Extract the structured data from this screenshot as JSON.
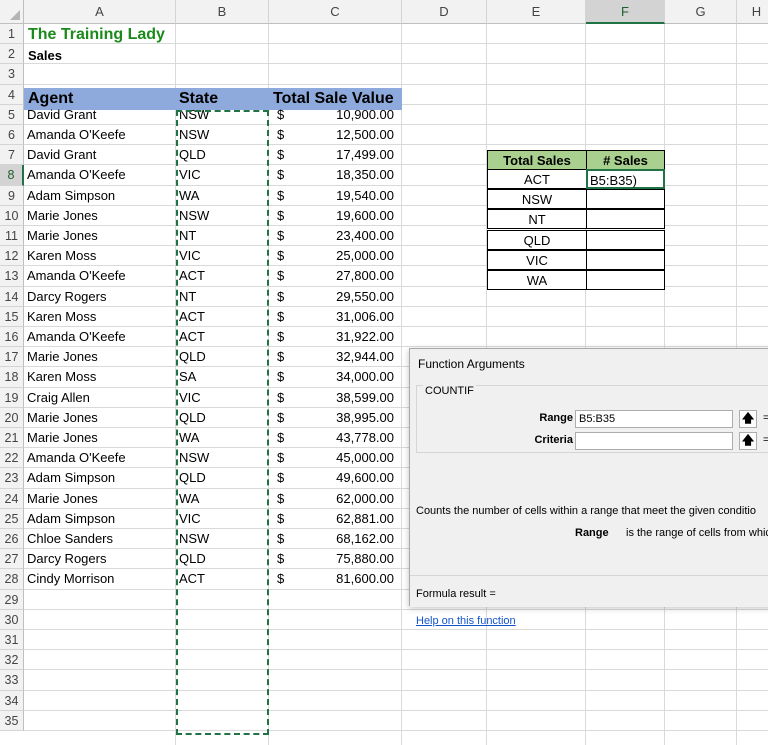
{
  "columns": [
    "A",
    "B",
    "C",
    "D",
    "E",
    "F",
    "G",
    "H"
  ],
  "active_column": "F",
  "rows": [
    "1",
    "2",
    "3",
    "4",
    "5",
    "6",
    "7",
    "8",
    "9",
    "10",
    "11",
    "12",
    "13",
    "14",
    "15",
    "16",
    "17",
    "18",
    "19",
    "20",
    "21",
    "22",
    "23",
    "24",
    "25",
    "26",
    "27",
    "28",
    "29",
    "30",
    "31",
    "32",
    "33",
    "34",
    "35"
  ],
  "active_row": "8",
  "title": "The Training Lady",
  "subtitle": "Sales",
  "table_headers": {
    "agent": "Agent",
    "state": "State",
    "value": "Total Sale Value"
  },
  "sales": [
    {
      "agent": "David Grant",
      "state": "NSW",
      "currency": "$",
      "value": "10,900.00"
    },
    {
      "agent": "Amanda O'Keefe",
      "state": "NSW",
      "currency": "$",
      "value": "12,500.00"
    },
    {
      "agent": "David Grant",
      "state": "QLD",
      "currency": "$",
      "value": "17,499.00"
    },
    {
      "agent": "Amanda O'Keefe",
      "state": "VIC",
      "currency": "$",
      "value": "18,350.00"
    },
    {
      "agent": "Adam Simpson",
      "state": "WA",
      "currency": "$",
      "value": "19,540.00"
    },
    {
      "agent": "Marie Jones",
      "state": "NSW",
      "currency": "$",
      "value": "19,600.00"
    },
    {
      "agent": "Marie Jones",
      "state": "NT",
      "currency": "$",
      "value": "23,400.00"
    },
    {
      "agent": "Karen Moss",
      "state": "VIC",
      "currency": "$",
      "value": "25,000.00"
    },
    {
      "agent": "Amanda O'Keefe",
      "state": "ACT",
      "currency": "$",
      "value": "27,800.00"
    },
    {
      "agent": "Darcy Rogers",
      "state": "NT",
      "currency": "$",
      "value": "29,550.00"
    },
    {
      "agent": "Karen Moss",
      "state": "ACT",
      "currency": "$",
      "value": "31,006.00"
    },
    {
      "agent": "Amanda O'Keefe",
      "state": "ACT",
      "currency": "$",
      "value": "31,922.00"
    },
    {
      "agent": "Marie Jones",
      "state": "QLD",
      "currency": "$",
      "value": "32,944.00"
    },
    {
      "agent": "Karen Moss",
      "state": "SA",
      "currency": "$",
      "value": "34,000.00"
    },
    {
      "agent": "Craig Allen",
      "state": "VIC",
      "currency": "$",
      "value": "38,599.00"
    },
    {
      "agent": "Marie Jones",
      "state": "QLD",
      "currency": "$",
      "value": "38,995.00"
    },
    {
      "agent": "Marie Jones",
      "state": "WA",
      "currency": "$",
      "value": "43,778.00"
    },
    {
      "agent": "Amanda O'Keefe",
      "state": "NSW",
      "currency": "$",
      "value": "45,000.00"
    },
    {
      "agent": "Adam Simpson",
      "state": "QLD",
      "currency": "$",
      "value": "49,600.00"
    },
    {
      "agent": "Marie Jones",
      "state": "WA",
      "currency": "$",
      "value": "62,000.00"
    },
    {
      "agent": "Adam Simpson",
      "state": "VIC",
      "currency": "$",
      "value": "62,881.00"
    },
    {
      "agent": "Chloe Sanders",
      "state": "NSW",
      "currency": "$",
      "value": "68,162.00"
    },
    {
      "agent": "Darcy Rogers",
      "state": "QLD",
      "currency": "$",
      "value": "75,880.00"
    },
    {
      "agent": "Cindy Morrison",
      "state": "ACT",
      "currency": "$",
      "value": "81,600.00"
    }
  ],
  "summary_table": {
    "headers": [
      "Total Sales",
      "# Sales"
    ],
    "states": [
      "ACT",
      "NSW",
      "NT",
      "QLD",
      "VIC",
      "WA"
    ],
    "active_cell_value": "B5:B35)"
  },
  "dialog": {
    "title": "Function Arguments",
    "function_name": "COUNTIF",
    "range_label": "Range",
    "range_value": "B5:B35",
    "criteria_label": "Criteria",
    "criteria_value": "",
    "equals": "=",
    "description": "Counts the number of cells within a range that meet the given conditio",
    "range_desc_label": "Range",
    "range_desc_text": "is the range of cells from which",
    "formula_result_label": "Formula result =",
    "help_link": "Help on this function"
  },
  "colors": {
    "title_green": "#1a8a1a",
    "header_band": "#8ea9db",
    "summary_header": "#a9d08e",
    "selection_green": "#217346",
    "link_blue": "#1155cc"
  }
}
